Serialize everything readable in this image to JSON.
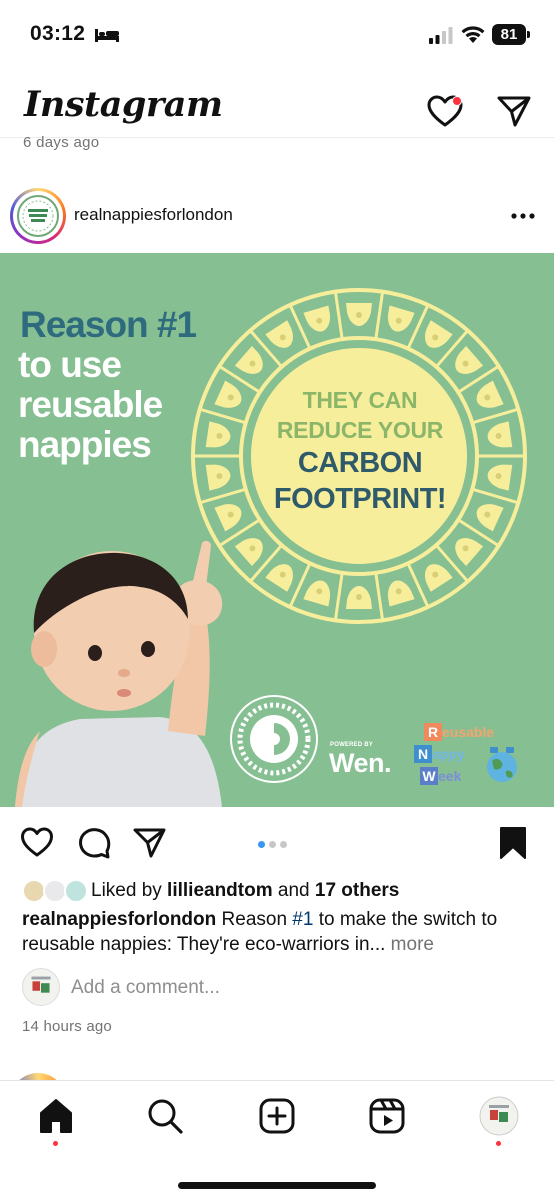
{
  "status_bar": {
    "time": "03:12",
    "battery": "81",
    "icons": [
      "bed-icon",
      "cellular-signal-icon",
      "wifi-icon",
      "battery-icon"
    ]
  },
  "header": {
    "logo": "Instagram",
    "icons": [
      "heart-icon",
      "direct-message-icon"
    ],
    "notification_color": "#ff3040"
  },
  "previous_post": {
    "timestamp": "6 days ago"
  },
  "post": {
    "username": "realnappiesforlondon",
    "image": {
      "title_line1": "Reason #1",
      "title_line2": "to use\nreusable\nnappies",
      "circle_line1": "THEY CAN",
      "circle_line2": "REDUCE YOUR",
      "circle_line3": "CARBON",
      "circle_line4": "FOOTPRINT!",
      "logo_text": "REAL NAPPIES FOR LONDON",
      "powered_by": "POWERED BY",
      "sponsor": "Wen.",
      "week_r": "R",
      "week_reusable": "eusable",
      "week_n": "N",
      "week_nappy": "appy",
      "week_w": "W",
      "week_week": "eek",
      "colors": {
        "background": "#86bf92",
        "circle": "#f7ee9c",
        "title_blue": "#2f6b7e"
      }
    },
    "carousel": {
      "count": 3,
      "active_index": 0
    },
    "likes": {
      "prefix": "Liked by ",
      "user": "lillieandtom",
      "middle": " and ",
      "others": "17 others"
    },
    "caption": {
      "username": "realnappiesforlondon",
      "text_before": " Reason ",
      "hashtag": "#1",
      "text_after": " to make the switch to reusable nappies: They're eco-warriors in...",
      "more": " more"
    },
    "comment_placeholder": "Add a comment...",
    "timestamp": "14 hours ago"
  },
  "bottom_nav": {
    "items": [
      "home-icon",
      "search-icon",
      "create-icon",
      "reels-icon",
      "profile-avatar"
    ],
    "active": "home-icon"
  }
}
